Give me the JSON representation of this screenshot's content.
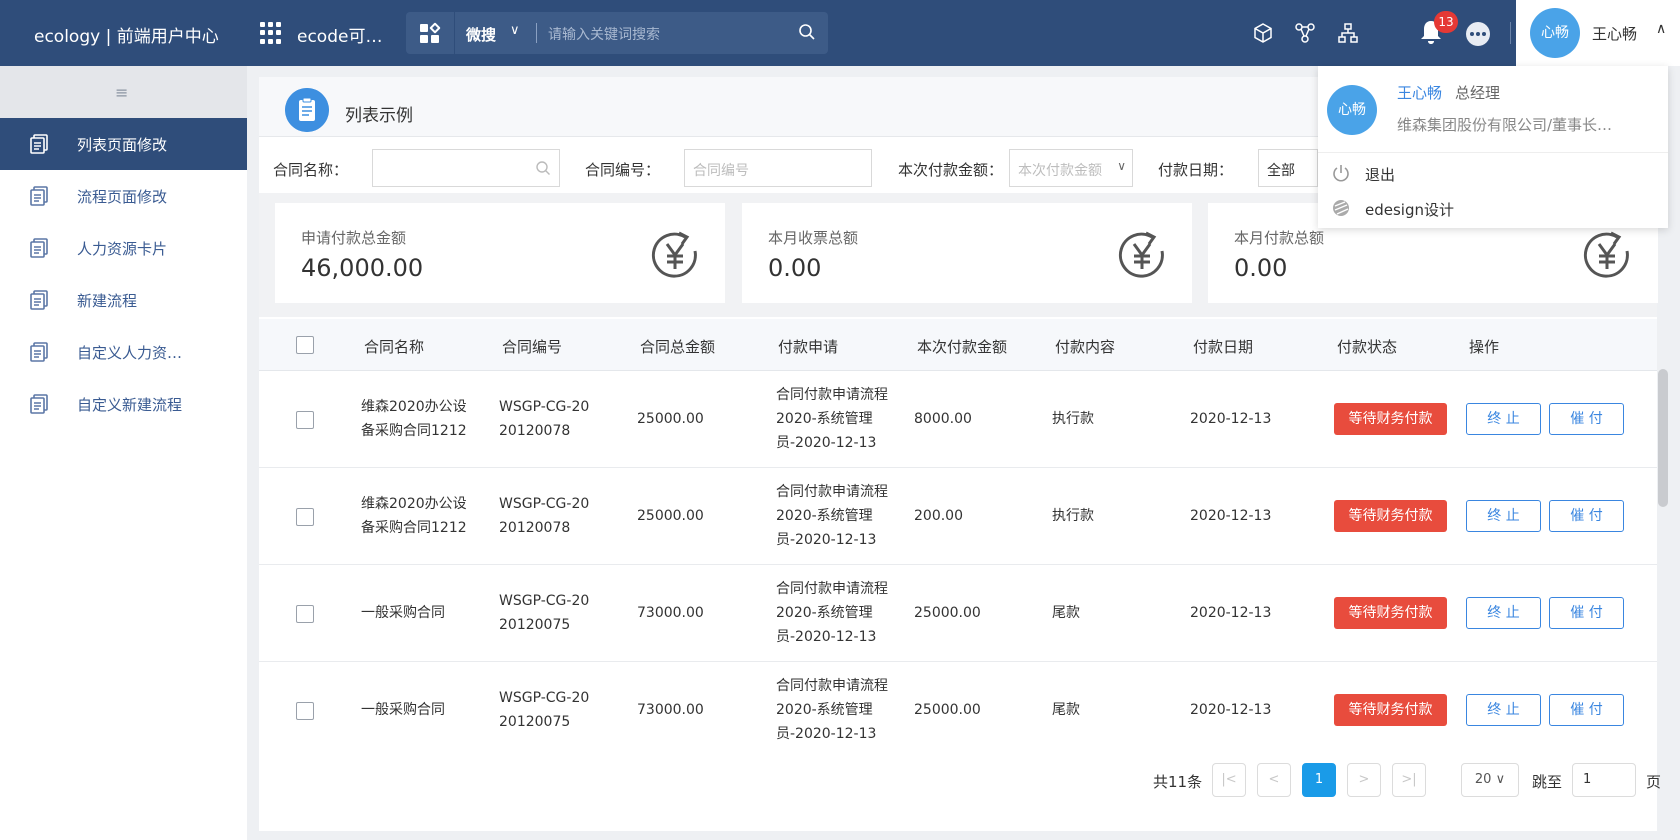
{
  "header": {
    "brand": "ecology | 前端用户中心",
    "app_name": "ecode可…",
    "search_type": "微搜",
    "search_placeholder": "请输入关键词搜索",
    "notification_count": "13",
    "user_avatar_text": "心畅",
    "user_name": "王心畅"
  },
  "sidebar": {
    "items": [
      {
        "label": "列表页面修改",
        "active": true
      },
      {
        "label": "流程页面修改"
      },
      {
        "label": "人力资源卡片"
      },
      {
        "label": "新建流程"
      },
      {
        "label": "自定义人力资…"
      },
      {
        "label": "自定义新建流程"
      }
    ]
  },
  "page": {
    "title": "列表示例"
  },
  "filters": {
    "contract_name_label": "合同名称：",
    "contract_no_label": "合同编号：",
    "contract_no_placeholder": "合同编号",
    "amount_label": "本次付款金额：",
    "amount_placeholder": "本次付款金额",
    "date_label": "付款日期：",
    "date_value": "全部"
  },
  "cards": [
    {
      "label": "申请付款总金额",
      "value": "46,000.00"
    },
    {
      "label": "本月收票总额",
      "value": "0.00"
    },
    {
      "label": "本月付款总额",
      "value": "0.00"
    }
  ],
  "table": {
    "headers": [
      "合同名称",
      "合同编号",
      "合同总金额",
      "付款申请",
      "本次付款金额",
      "付款内容",
      "付款日期",
      "付款状态",
      "操作"
    ],
    "rows": [
      {
        "name": "维森2020办公设备采购合同1212",
        "no": "WSGP-CG-2020120078",
        "total": "25000.00",
        "apply": "合同付款申请流程2020-系统管理员-2020-12-13",
        "amount": "8000.00",
        "content": "执行款",
        "date": "2020-12-13",
        "status": "等待财务付款"
      },
      {
        "name": "维森2020办公设备采购合同1212",
        "no": "WSGP-CG-2020120078",
        "total": "25000.00",
        "apply": "合同付款申请流程2020-系统管理员-2020-12-13",
        "amount": "200.00",
        "content": "执行款",
        "date": "2020-12-13",
        "status": "等待财务付款"
      },
      {
        "name": "一般采购合同",
        "no": "WSGP-CG-2020120075",
        "total": "73000.00",
        "apply": "合同付款申请流程2020-系统管理员-2020-12-13",
        "amount": "25000.00",
        "content": "尾款",
        "date": "2020-12-13",
        "status": "等待财务付款"
      },
      {
        "name": "一般采购合同",
        "no": "WSGP-CG-2020120075",
        "total": "73000.00",
        "apply": "合同付款申请流程2020-系统管理员-2020-12-13",
        "amount": "25000.00",
        "content": "尾款",
        "date": "2020-12-13",
        "status": "等待财务付款"
      }
    ],
    "terminate_label": "终 止",
    "urge_label": "催 付"
  },
  "pagination": {
    "total_text": "共11条",
    "current_page": "1",
    "page_size": "20",
    "jump_label": "跳至",
    "jump_value": "1",
    "page_suffix": "页"
  },
  "user_dropdown": {
    "avatar_text": "心畅",
    "name": "王心畅",
    "title": "总经理",
    "org": "维森集团股份有限公司/董事长…",
    "logout": "退出",
    "edesign": "edesign设计"
  },
  "colors": {
    "header_bg": "#2f4d7a",
    "accent": "#3a86e0",
    "status_red": "#e84c3d",
    "badge_red": "#e53935"
  }
}
